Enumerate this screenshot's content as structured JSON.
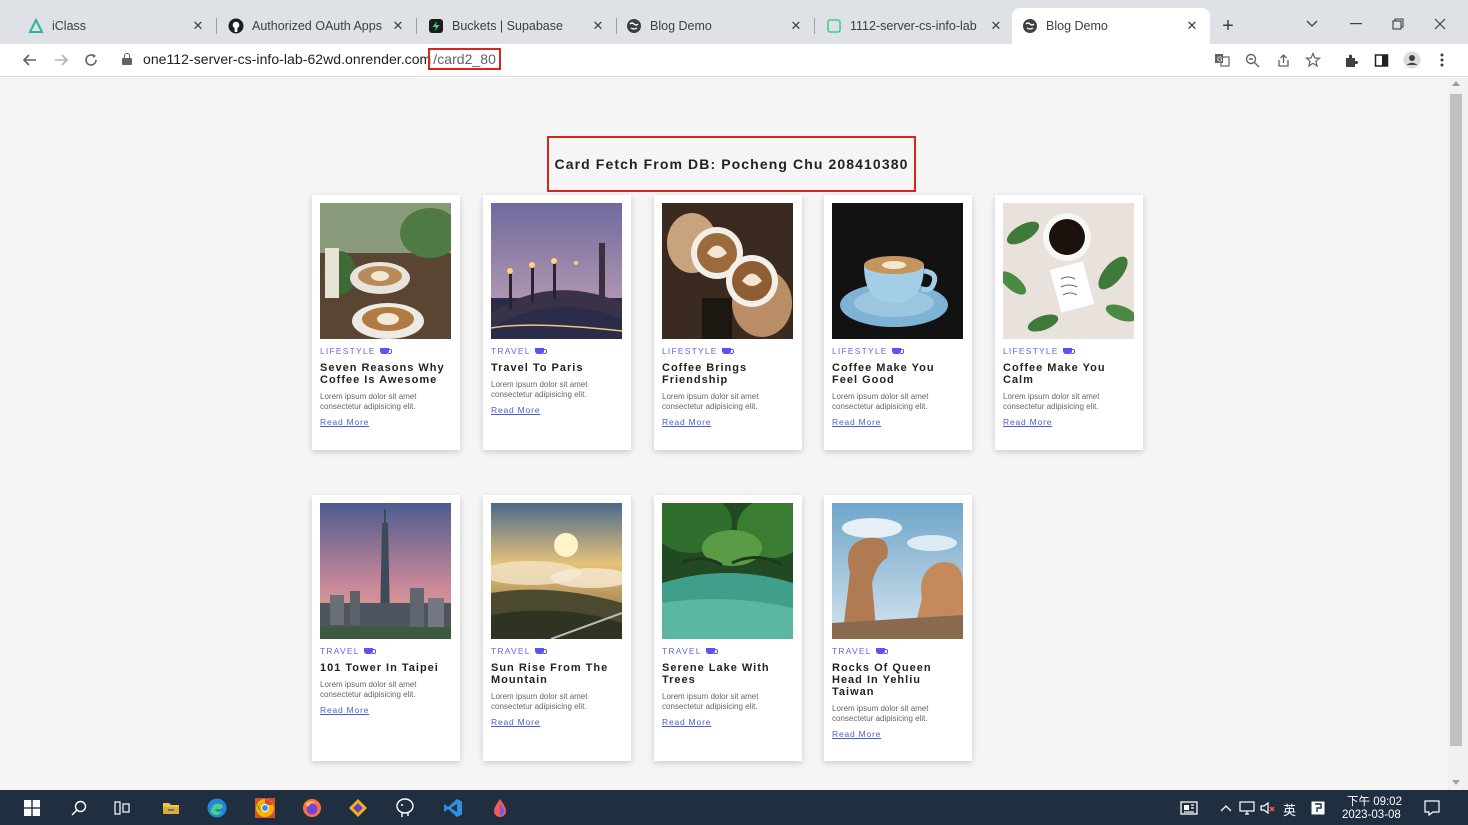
{
  "tabs": [
    {
      "title": "iClass",
      "icon": "iclass-icon"
    },
    {
      "title": "Authorized OAuth Apps",
      "icon": "github-icon"
    },
    {
      "title": "Buckets | Supabase",
      "icon": "supabase-icon"
    },
    {
      "title": "Blog Demo",
      "icon": "globe-icon"
    },
    {
      "title": "1112-server-cs-info-lab",
      "icon": "render-icon"
    },
    {
      "title": "Blog Demo",
      "icon": "globe-icon"
    }
  ],
  "address_bar": {
    "host": "one112-server-cs-info-lab-62wd.onrender.com",
    "path": "/card2_80"
  },
  "page": {
    "heading": "Card Fetch From DB: Pocheng Chu 208410380",
    "cards": [
      {
        "category": "LIFESTYLE",
        "title": "Seven Reasons Why Coffee Is Awesome",
        "desc": "Lorem ipsum dolor sit amet consectetur adipisicing elit.",
        "link": "Read More",
        "image": "coffee-latte-art-photo"
      },
      {
        "category": "TRAVEL",
        "title": "Travel To Paris",
        "desc": "Lorem ipsum dolor sit amet consectetur adipisicing elit.",
        "link": "Read More",
        "image": "paris-bridge-photo"
      },
      {
        "category": "LIFESTYLE",
        "title": "Coffee Brings Friendship",
        "desc": "Lorem ipsum dolor sit amet consectetur adipisicing elit.",
        "link": "Read More",
        "image": "coffee-cups-cheers-photo"
      },
      {
        "category": "LIFESTYLE",
        "title": "Coffee Make You Feel Good",
        "desc": "Lorem ipsum dolor sit amet consectetur adipisicing elit.",
        "link": "Read More",
        "image": "coffee-cup-saucer-photo"
      },
      {
        "category": "LIFESTYLE",
        "title": "Coffee Make You Calm",
        "desc": "Lorem ipsum dolor sit amet consectetur adipisicing elit.",
        "link": "Read More",
        "image": "coffee-leaves-note-photo"
      },
      {
        "category": "TRAVEL",
        "title": "101 Tower In Taipei",
        "desc": "Lorem ipsum dolor sit amet consectetur adipisicing elit.",
        "link": "Read More",
        "image": "taipei-101-photo"
      },
      {
        "category": "TRAVEL",
        "title": "Sun Rise From The Mountain",
        "desc": "Lorem ipsum dolor sit amet consectetur adipisicing elit.",
        "link": "Read More",
        "image": "mountain-sunrise-photo"
      },
      {
        "category": "TRAVEL",
        "title": "Serene Lake With Trees",
        "desc": "Lorem ipsum dolor sit amet consectetur adipisicing elit.",
        "link": "Read More",
        "image": "lake-trees-photo"
      },
      {
        "category": "TRAVEL",
        "title": "Rocks Of Queen Head In Yehliu Taiwan",
        "desc": "Lorem ipsum dolor sit amet consectetur adipisicing elit.",
        "link": "Read More",
        "image": "yehliu-rocks-photo"
      }
    ]
  },
  "taskbar": {
    "ime": "英",
    "time": "下午 09:02",
    "date": "2023-03-08"
  },
  "colors": {
    "accent": "#6366f1",
    "highlight": "#d9261c",
    "taskbar": "#1f2f3f"
  }
}
